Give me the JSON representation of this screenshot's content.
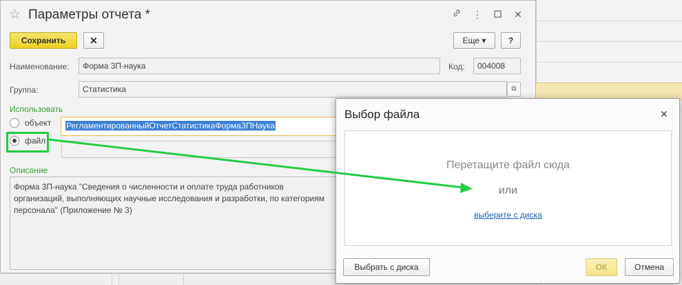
{
  "form": {
    "title": "Параметры отчета *",
    "toolbar": {
      "save_label": "Сохранить",
      "close_label": "✕",
      "more_label": "Еще ▾",
      "help_label": "?"
    },
    "name": {
      "label": "Наименование:",
      "value": "Форма 3П-наука"
    },
    "code": {
      "label": "Код:",
      "value": "004008"
    },
    "group": {
      "label": "Группа:",
      "value": "Статистика"
    },
    "use": {
      "label": "Использовать",
      "options": [
        {
          "label": "объект",
          "selected": false
        },
        {
          "label": "файл",
          "selected": true
        }
      ],
      "object_value": "РегламентированныйОтчетСтатистикаФормаЗПНаука"
    },
    "description": {
      "label": "Описание",
      "text": "Форма 3П-наука  \"Сведения о численности и оплате труда  работников организаций, выполняющих научные исследования и разработки, по категориям персонала\" (Приложение № 3)"
    }
  },
  "dialog": {
    "title": "Выбор файла",
    "drop_text": "Перетащите файл сюда",
    "or_text": "или",
    "link_text": "выберите с диска",
    "choose_button": "Выбрать с диска",
    "ok_button": "ОК",
    "cancel_button": "Отмена"
  },
  "colors": {
    "save_button": "#ecd023",
    "highlight": "#22cc44",
    "link": "#1f5fae",
    "section_label": "#3a9a3a"
  },
  "icons": [
    "star-icon",
    "link-icon",
    "more-vert-icon",
    "maximize-icon",
    "close-icon",
    "open-icon"
  ]
}
